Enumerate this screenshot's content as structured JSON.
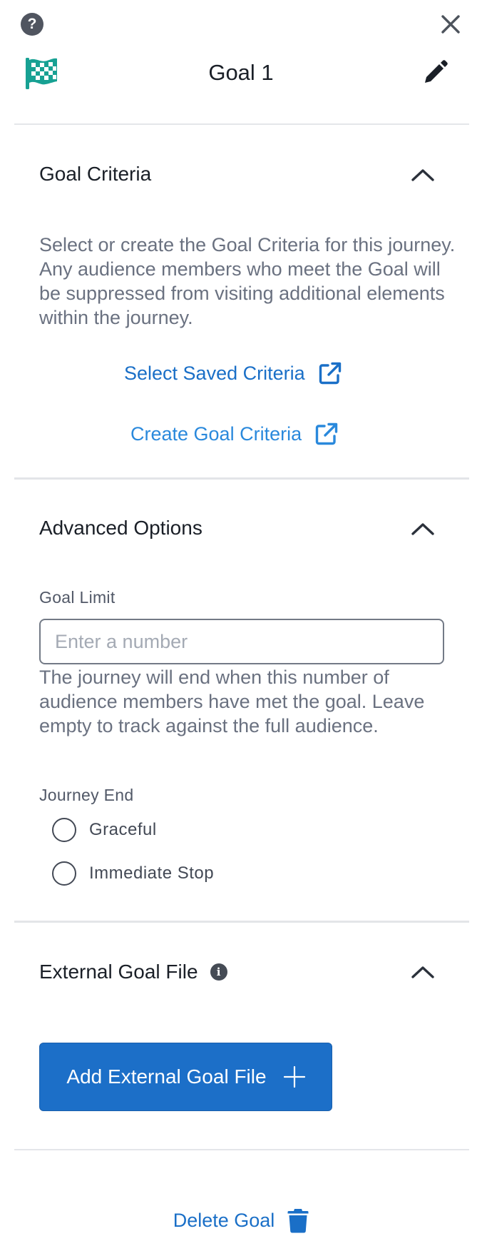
{
  "header": {
    "help_icon": "question-circle",
    "help_glyph": "?",
    "close_icon": "close-x",
    "flag_icon": "checkered-flag",
    "flag_color": "#17a193",
    "title": "Goal 1",
    "edit_icon": "pencil"
  },
  "goal_criteria": {
    "title": "Goal Criteria",
    "expanded": true,
    "description": "Select or create the Goal Criteria for this journey. Any audience members who meet the Goal will be suppressed from visiting additional elements within the journey.",
    "select_saved_label": "Select Saved Criteria",
    "create_label": "Create Goal Criteria",
    "link_icon": "external-link"
  },
  "advanced_options": {
    "title": "Advanced Options",
    "expanded": true,
    "goal_limit_label": "Goal Limit",
    "goal_limit_value": "",
    "goal_limit_placeholder": "Enter a number",
    "goal_limit_help": "The journey will end when this number of audience members have met the goal. Leave empty to track against the full audience.",
    "journey_end_label": "Journey End",
    "journey_end_options": [
      "Graceful",
      "Immediate Stop"
    ]
  },
  "external_goal_file": {
    "title": "External Goal File",
    "info_icon": "info-circle",
    "info_glyph": "i",
    "expanded": true,
    "add_button_label": "Add External Goal File",
    "add_icon": "plus"
  },
  "footer": {
    "delete_label": "Delete Goal",
    "delete_icon": "trash"
  },
  "colors": {
    "accent": "#1c6fc8",
    "link_light": "#2a89dc",
    "flag_teal": "#17a193"
  }
}
